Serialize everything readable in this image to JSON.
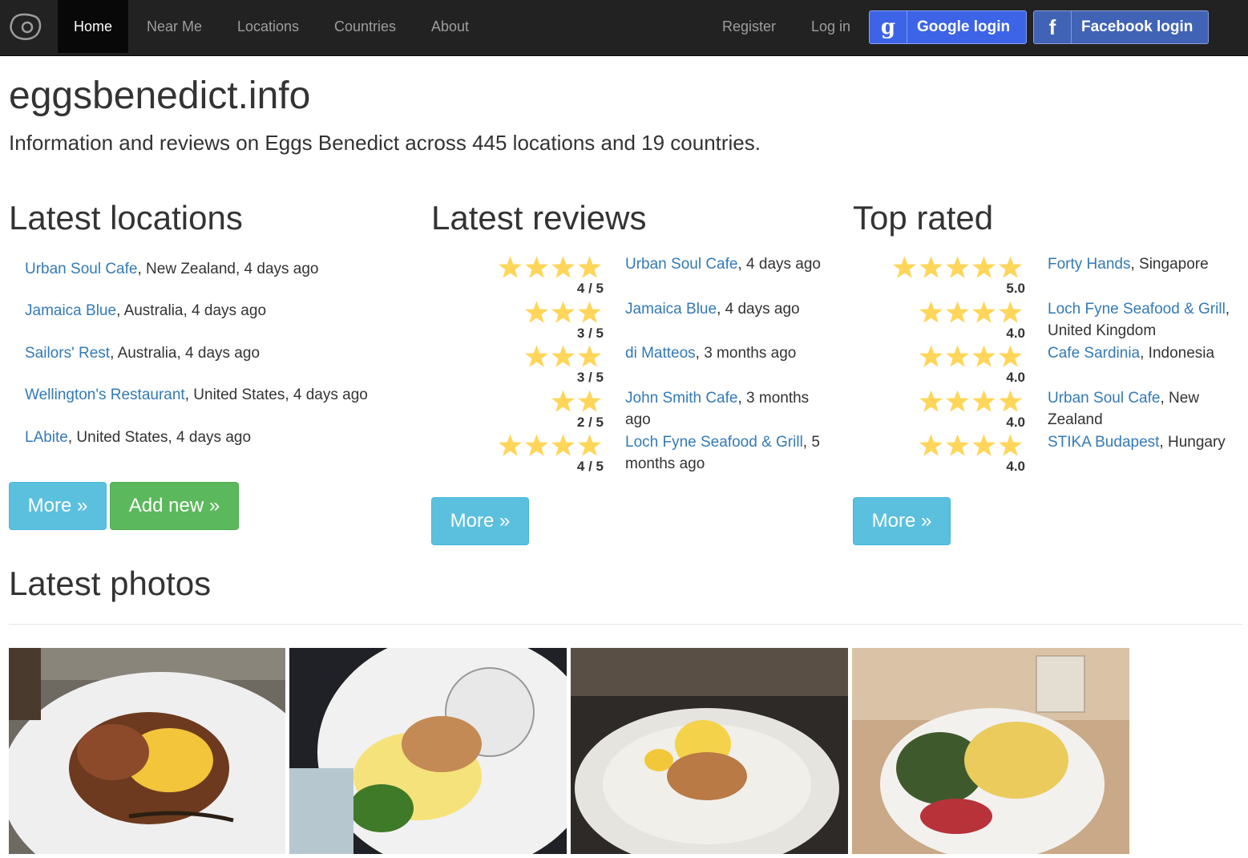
{
  "nav": {
    "brand_icon": "egg-icon",
    "items": [
      "Home",
      "Near Me",
      "Locations",
      "Countries",
      "About"
    ],
    "register": "Register",
    "login": "Log in",
    "google_label": "Google login",
    "google_icon_glyph": "g",
    "facebook_label": "Facebook login",
    "facebook_icon_glyph": "f"
  },
  "header": {
    "title": "eggsbenedict.info",
    "lead": "Information and reviews on Eggs Benedict across 445 locations and 19 countries."
  },
  "latest_locations": {
    "heading": "Latest locations",
    "items": [
      {
        "name": "Urban Soul Cafe",
        "rest": ", New Zealand, 4 days ago"
      },
      {
        "name": "Jamaica Blue",
        "rest": ", Australia, 4 days ago"
      },
      {
        "name": "Sailors' Rest",
        "rest": ", Australia, 4 days ago"
      },
      {
        "name": "Wellington's Restaurant",
        "rest": ", United States, 4 days ago"
      },
      {
        "name": "LAbite",
        "rest": ", United States, 4 days ago"
      }
    ],
    "more": "More »",
    "add_new": "Add new »"
  },
  "latest_reviews": {
    "heading": "Latest reviews",
    "items": [
      {
        "name": "Urban Soul Cafe",
        "rest": ", 4 days ago",
        "stars": 4,
        "score": "4 / 5"
      },
      {
        "name": "Jamaica Blue",
        "rest": ", 4 days ago",
        "stars": 3,
        "score": "3 / 5"
      },
      {
        "name": "di Matteos",
        "rest": ", 3 months ago",
        "stars": 3,
        "score": "3 / 5"
      },
      {
        "name": "John Smith Cafe",
        "rest": ", 3 months ago",
        "stars": 2,
        "score": "2 / 5"
      },
      {
        "name": "Loch Fyne Seafood & Grill",
        "rest": ", 5 months ago",
        "stars": 4,
        "score": "4 / 5"
      }
    ],
    "more": "More »"
  },
  "top_rated": {
    "heading": "Top rated",
    "items": [
      {
        "name": "Forty Hands",
        "rest": ", Singapore",
        "stars": 5,
        "score": "5.0"
      },
      {
        "name": "Loch Fyne Seafood & Grill",
        "rest": ", United Kingdom",
        "stars": 4,
        "score": "4.0"
      },
      {
        "name": "Cafe Sardinia",
        "rest": ", Indonesia",
        "stars": 4,
        "score": "4.0"
      },
      {
        "name": "Urban Soul Cafe",
        "rest": ", New Zealand",
        "stars": 4,
        "score": "4.0"
      },
      {
        "name": "STIKA Budapest",
        "rest": ", Hungary",
        "stars": 4,
        "score": "4.0"
      }
    ],
    "more": "More »"
  },
  "latest_photos": {
    "heading": "Latest photos"
  },
  "colors": {
    "link": "#337ab7",
    "star": "#ffd65a",
    "info": "#5bc0de",
    "success": "#5cb85c"
  }
}
